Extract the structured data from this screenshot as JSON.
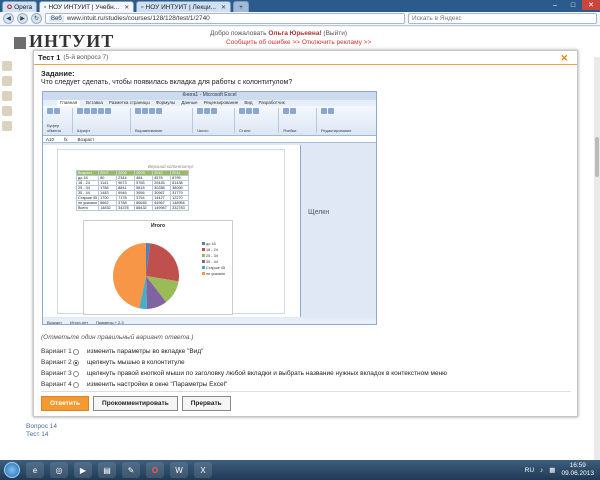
{
  "browser": {
    "tabs": [
      {
        "label": "Opera",
        "active": false
      },
      {
        "label": "НОУ ИНТУИТ | Учебн...",
        "active": true
      },
      {
        "label": "НОУ ИНТУИТ | Лекци...",
        "active": false
      }
    ],
    "url": "www.intuit.ru/studies/courses/128/128/test/1/2740",
    "url_badge": "Веб",
    "search_placeholder": "Искать в Яндекс"
  },
  "site": {
    "logo": "ИНТУИТ",
    "welcome_prefix": "Добро пожаловать",
    "user_name": "Ольга Юрьевна!",
    "logout": "(Выйти)",
    "links": "Сообщить об ошибке >>   Отключить рекламу >>",
    "tests": [
      "Вопрос 14",
      "Тест 14"
    ]
  },
  "modal": {
    "title": "Тест 1",
    "subtitle": "(5-й вопросз 7)",
    "task_label": "Задание:",
    "question": "Что следует сделать, чтобы появилась вкладка для работы с колонтитулом?",
    "hint": "(Отметьте один правильный вариант ответа.)",
    "options": [
      {
        "label": "Вариант 1",
        "text": "изменить параметры во вкладке \"Вид\"",
        "selected": false
      },
      {
        "label": "Вариант 2",
        "text": "щелкнуть мышью в колонтитуле",
        "selected": true
      },
      {
        "label": "Вариант 3",
        "text": "щелкнуть правой кнопкой мыши по заголовку любой вкладки и выбрать название нужных вкладок в контекстном меню",
        "selected": false
      },
      {
        "label": "Вариант 4",
        "text": "изменить настройки в окне \"Параметры Excel\"",
        "selected": false
      }
    ],
    "buttons": {
      "answer": "Ответить",
      "comment": "Прокомментировать",
      "skip": "Прервать"
    }
  },
  "excel": {
    "title": "Книга1 - Microsoft Excel",
    "tabs": [
      "Главная",
      "Вставка",
      "Разметка страницы",
      "Формулы",
      "Данные",
      "Рецензирование",
      "Вид",
      "Разработчик"
    ],
    "ribbon_groups": [
      "Буфер обмена",
      "Шрифт",
      "Выравнивание",
      "Число",
      "Стили",
      "Ячейки",
      "Редактирование"
    ],
    "name_box": "A10",
    "formula_text": "Возраст",
    "header_text": "Верхний колонтитул",
    "right_pane_text": "Щелкн",
    "table": [
      [
        "Возраст",
        "2007",
        "2008",
        "2009",
        "2010",
        "2011"
      ],
      [
        "до 18",
        "80",
        "2344",
        "484",
        "4578",
        "8795"
      ],
      [
        "18 - 24",
        "1141",
        "9673",
        "5765",
        "29445",
        "81438"
      ],
      [
        "25 - 34",
        "1786",
        "8841",
        "5818",
        "30288",
        "38055"
      ],
      [
        "35 - 44",
        "1483",
        "6946",
        "3956",
        "30967",
        "31779"
      ],
      [
        "Старше 45",
        "1700",
        "7178",
        "3754",
        "14427",
        "12270"
      ],
      [
        "не указано",
        "8662",
        "3788",
        "86645",
        "44967",
        "148956"
      ],
      [
        "Всего",
        "14832",
        "34378",
        "88432",
        "149987",
        "332783"
      ]
    ],
    "chart": {
      "title": "Итого",
      "legend": [
        "до 18",
        "18 - 24",
        "25 - 34",
        "35 - 44",
        "Старше 45",
        "не указано"
      ]
    },
    "sheet_tabs": [
      "Возраст",
      "Итого-лет",
      "Примеры + 2.3"
    ]
  },
  "taskbar": {
    "lang": "RU",
    "time": "16:59",
    "date": "09.06.2013"
  },
  "chart_data": {
    "type": "pie",
    "title": "Итого",
    "categories": [
      "до 18",
      "18 - 24",
      "25 - 34",
      "35 - 44",
      "Старше 45",
      "не указано"
    ],
    "values": [
      6795,
      81438,
      38055,
      31779,
      12270,
      148956
    ],
    "colors": [
      "#4f81bd",
      "#c0504d",
      "#9bbb59",
      "#8064a2",
      "#4bacc6",
      "#f79646"
    ]
  }
}
